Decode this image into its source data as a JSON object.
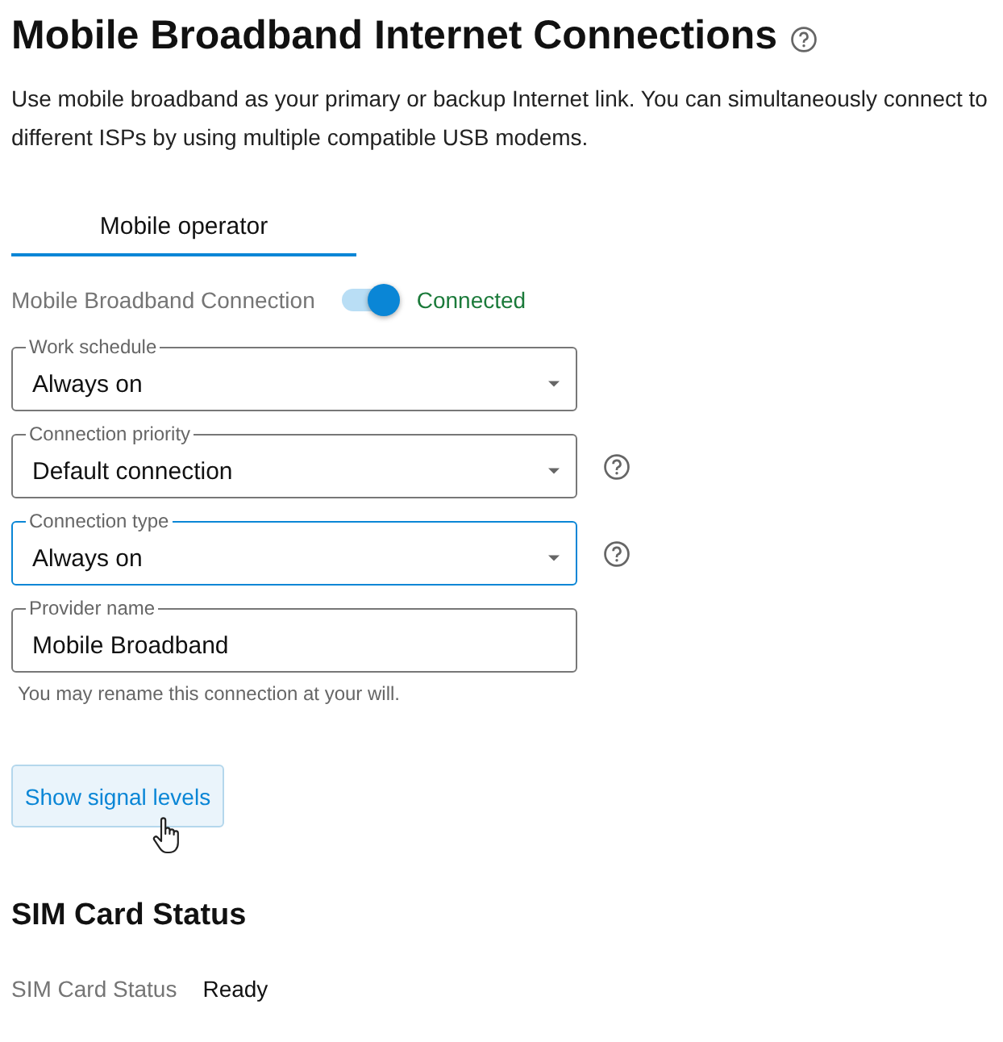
{
  "page": {
    "title": "Mobile Broadband Internet Connections",
    "description": "Use mobile broadband as your primary or backup Internet link. You can simultaneously connect to different ISPs by using multiple compatible USB modems."
  },
  "tabs": [
    {
      "label": "Mobile operator",
      "selected": true
    }
  ],
  "connection": {
    "label": "Mobile Broadband Connection",
    "on": true,
    "status": "Connected"
  },
  "fields": [
    {
      "kind": "select",
      "label": "Work schedule",
      "value": "Always on",
      "focused": false,
      "help": false
    },
    {
      "kind": "select",
      "label": "Connection priority",
      "value": "Default connection",
      "focused": false,
      "help": true
    },
    {
      "kind": "select",
      "label": "Connection type",
      "value": "Always on",
      "focused": true,
      "help": true
    },
    {
      "kind": "text",
      "label": "Provider name",
      "value": "Mobile Broadband",
      "focused": false,
      "help": false,
      "hint": "You may rename this connection at your will."
    }
  ],
  "signal_button": {
    "label": "Show signal levels"
  },
  "sim": {
    "heading": "SIM Card Status",
    "rows": [
      {
        "label": "SIM Card Status",
        "value": "Ready"
      }
    ]
  }
}
